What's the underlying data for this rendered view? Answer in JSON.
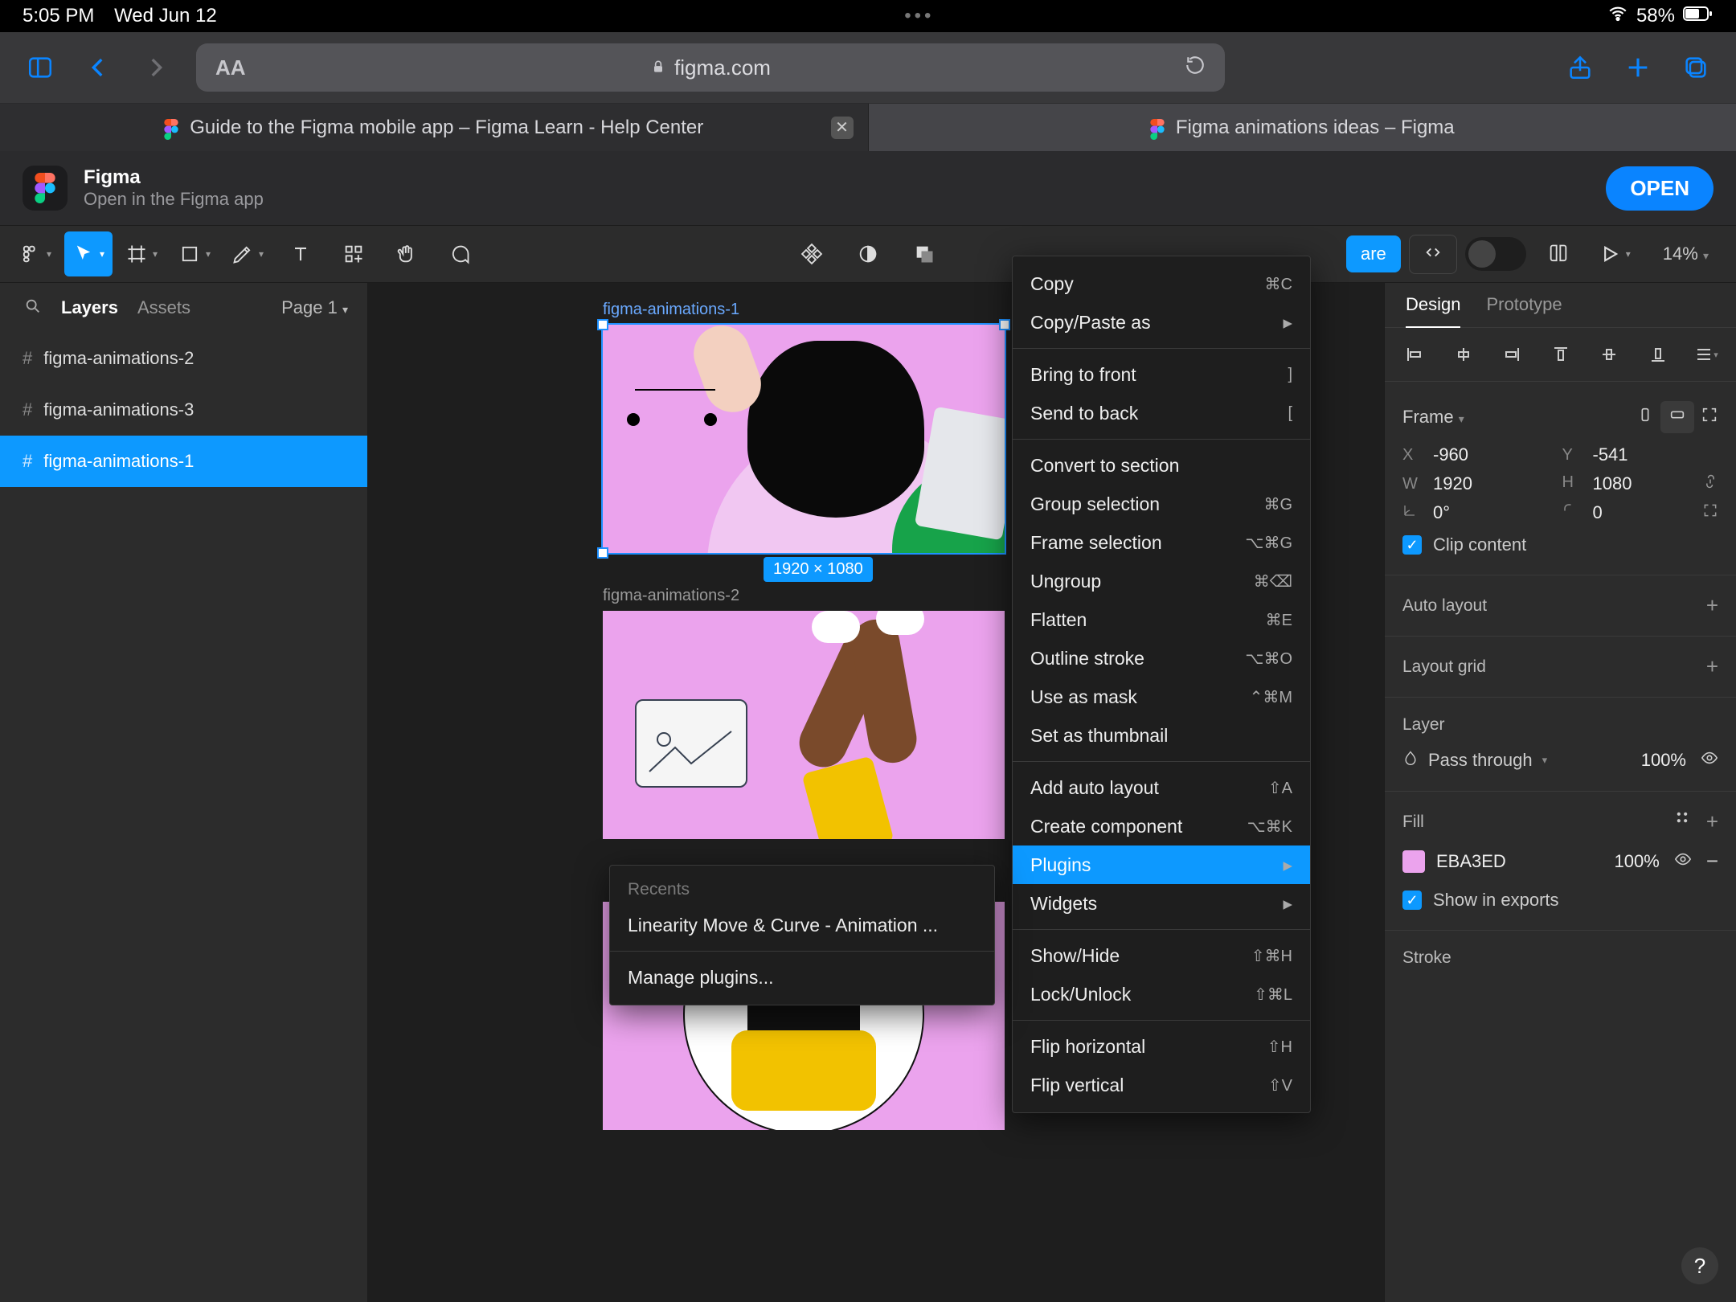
{
  "status": {
    "time": "5:05 PM",
    "date": "Wed Jun 12",
    "battery": "58%"
  },
  "safari": {
    "domain": "figma.com",
    "tabs": [
      {
        "title": "Guide to the Figma mobile app – Figma Learn - Help Center",
        "active": false
      },
      {
        "title": "Figma animations ideas – Figma",
        "active": true
      }
    ]
  },
  "banner": {
    "app": "Figma",
    "sub": "Open in the Figma app",
    "cta": "OPEN"
  },
  "toolbar": {
    "zoom": "14%",
    "share": "are"
  },
  "leftpanel": {
    "layers_label": "Layers",
    "assets_label": "Assets",
    "page_label": "Page 1",
    "items": [
      {
        "name": "figma-animations-2"
      },
      {
        "name": "figma-animations-3"
      },
      {
        "name": "figma-animations-1"
      }
    ],
    "selected_index": 2
  },
  "canvas": {
    "frames": [
      {
        "name": "figma-animations-1",
        "dims": "1920 × 1080",
        "selected": true
      },
      {
        "name": "figma-animations-2",
        "selected": false
      },
      {
        "name": "figma-animations-3",
        "selected": false
      }
    ]
  },
  "context_menu": {
    "groups": [
      [
        {
          "label": "Copy",
          "shortcut": "⌘C"
        },
        {
          "label": "Copy/Paste as",
          "submenu": true
        }
      ],
      [
        {
          "label": "Bring to front",
          "shortcut": "]"
        },
        {
          "label": "Send to back",
          "shortcut": "["
        }
      ],
      [
        {
          "label": "Convert to section"
        },
        {
          "label": "Group selection",
          "shortcut": "⌘G"
        },
        {
          "label": "Frame selection",
          "shortcut": "⌥⌘G"
        },
        {
          "label": "Ungroup",
          "shortcut": "⌘⌫"
        },
        {
          "label": "Flatten",
          "shortcut": "⌘E"
        },
        {
          "label": "Outline stroke",
          "shortcut": "⌥⌘O"
        },
        {
          "label": "Use as mask",
          "shortcut": "⌃⌘M"
        },
        {
          "label": "Set as thumbnail"
        }
      ],
      [
        {
          "label": "Add auto layout",
          "shortcut": "⇧A"
        },
        {
          "label": "Create component",
          "shortcut": "⌥⌘K"
        },
        {
          "label": "Plugins",
          "submenu": true,
          "highlight": true
        },
        {
          "label": "Widgets",
          "submenu": true
        }
      ],
      [
        {
          "label": "Show/Hide",
          "shortcut": "⇧⌘H"
        },
        {
          "label": "Lock/Unlock",
          "shortcut": "⇧⌘L"
        }
      ],
      [
        {
          "label": "Flip horizontal",
          "shortcut": "⇧H"
        },
        {
          "label": "Flip vertical",
          "shortcut": "⇧V"
        }
      ]
    ],
    "plugins_submenu": {
      "header": "Recents",
      "items": [
        "Linearity Move & Curve - Animation ..."
      ],
      "footer": "Manage plugins..."
    }
  },
  "design": {
    "tab_design": "Design",
    "tab_proto": "Prototype",
    "frame_label": "Frame",
    "x_label": "X",
    "x_val": "-960",
    "y_label": "Y",
    "y_val": "-541",
    "w_label": "W",
    "w_val": "1920",
    "h_label": "H",
    "h_val": "1080",
    "rot_val": "0°",
    "corner_val": "0",
    "clip_label": "Clip content",
    "autolayout": "Auto layout",
    "layoutgrid": "Layout grid",
    "layer_label": "Layer",
    "blend": "Pass through",
    "opacity": "100%",
    "fill_label": "Fill",
    "fill_hex": "EBA3ED",
    "fill_opacity": "100%",
    "show_exports": "Show in exports",
    "stroke_label": "Stroke"
  },
  "colors": {
    "accent": "#0d99ff",
    "safari_blue": "#0a84ff",
    "frame_fill": "#eba3ed"
  }
}
